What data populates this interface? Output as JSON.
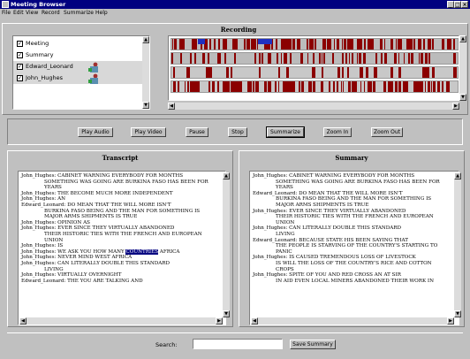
{
  "window": {
    "title": "Meeting Browser",
    "controls": {
      "minimize": "_",
      "maximize": "□",
      "close": "×"
    }
  },
  "menu": [
    "File",
    "Edit",
    "View",
    "Record",
    "Summarize",
    "Help"
  ],
  "recording": {
    "label": "Recording",
    "tracks": [
      {
        "label": "Meeting",
        "checked": "✓",
        "avatar": false
      },
      {
        "label": "Summary",
        "checked": "✓",
        "avatar": false
      },
      {
        "label": "Edward_Leonard",
        "checked": "✓",
        "avatar": true
      },
      {
        "label": "John_Hughes",
        "checked": "✓",
        "avatar": true
      }
    ]
  },
  "buttons": {
    "play_audio": "Play Audio",
    "play_video": "Play Video",
    "pause": "Pause",
    "stop": "Stop",
    "summarize": "Summarize",
    "zoom_in": "Zoom In",
    "zoom_out": "Zoom Out"
  },
  "transcript": {
    "title": "Transcript",
    "lines": [
      {
        "speaker": "John_Hughes",
        "text": "CABINET WARNING EVERYBODY FOR MONTHS"
      },
      {
        "cont": "SOMETHING WAS GOING ARE BURKINA FASO HAS BEEN FOR"
      },
      {
        "cont": "YEARS"
      },
      {
        "speaker": "John_Hughes",
        "text": "THE BECOME MUCH MORE INDEPENDENT"
      },
      {
        "speaker": "John_Hughes",
        "text": "AN"
      },
      {
        "speaker": "Edward_Leonard",
        "text": "DO MEAN THAT THE WILL MORE ISN'T"
      },
      {
        "cont": "BURKINA FASO BEING AND THE MAN FOR SOMETHING IS"
      },
      {
        "cont": "MAJOR ARMS SHIPMENTS IS TRUE"
      },
      {
        "speaker": "John_Hughes",
        "text": "OPINION AS"
      },
      {
        "speaker": "John_Hughes",
        "text": "EVER SINCE THEY VIRTUALLY ABANDONED"
      },
      {
        "cont": "THEIR HISTORIC TIES WITH THE FRENCH AND EUROPEAN"
      },
      {
        "cont": "UNION"
      },
      {
        "speaker": "John_Hughes",
        "text": "IS"
      },
      {
        "speaker": "John_Hughes",
        "text": "WE ASK YOU HOW MANY ",
        "highlight": "COUNTRIES",
        "after": " AFRICA"
      },
      {
        "speaker": "John_Hughes",
        "text": "NEVER MIND WEST AFRICA"
      },
      {
        "speaker": "John_Hughes",
        "text": "CAN LITERALLY DOUBLE THIS STANDARD"
      },
      {
        "cont": "LIVING"
      },
      {
        "speaker": "John_Hughes",
        "text": "VIRTUALLY OVERNIGHT"
      },
      {
        "speaker": "Edward_Leonard",
        "text": "THE YOU ARE TALKING AND"
      }
    ]
  },
  "summary": {
    "title": "Summary",
    "lines": [
      {
        "speaker": "John_Hughes",
        "text": "CABINET WARNING EVERYBODY FOR MONTHS"
      },
      {
        "cont": "SOMETHING WAS GOING ARE BURKINA FASO HAS BEEN FOR"
      },
      {
        "cont": "YEARS"
      },
      {
        "speaker": "Edward_Leonard",
        "text": "DO MEAN THAT THE WILL MORE ISN'T"
      },
      {
        "cont": "BURKINA FASO BEING AND THE MAN FOR SOMETHING IS"
      },
      {
        "cont": "MAJOR ARMS SHIPMENTS IS TRUE"
      },
      {
        "speaker": "John_Hughes",
        "text": "EVER SINCE THEY VIRTUALLY ABANDONED"
      },
      {
        "cont": "THEIR HISTORIC TIES WITH THE FRENCH AND EUROPEAN"
      },
      {
        "cont": "UNION"
      },
      {
        "speaker": "John_Hughes",
        "text": "CAN LITERALLY DOUBLE THIS STANDARD"
      },
      {
        "cont": "LIVING"
      },
      {
        "speaker": "Edward_Leonard",
        "text": "BECAUSE STATE HIS BEEN SAYING THAT"
      },
      {
        "cont": "THE PEOPLE IS STARVING OF THE COUNTRY'S STARTING TO"
      },
      {
        "cont": "PANIC"
      },
      {
        "speaker": "John_Hughes",
        "text": "IS CAUSED TREMENDOUS LOSS OF LIVESTOCK"
      },
      {
        "cont": "IS WILL THE LOSS OF THE COUNTRY'S RICE AND COTTON"
      },
      {
        "cont": "CROPS"
      },
      {
        "speaker": "John_Hughes",
        "text": "SPITE OF YOU AND RED CROSS AN AT SIR"
      },
      {
        "cont": "IN AID EVEN LOCAL MINERS ABANDONED THEIR WORK IN"
      }
    ]
  },
  "search": {
    "label": "Search:",
    "value": "",
    "save_label": "Save Summary"
  },
  "colors": {
    "titlebar": "#000080",
    "segment_red": "#8b0000",
    "segment_blue": "#2030c0",
    "highlight": "#000080"
  }
}
